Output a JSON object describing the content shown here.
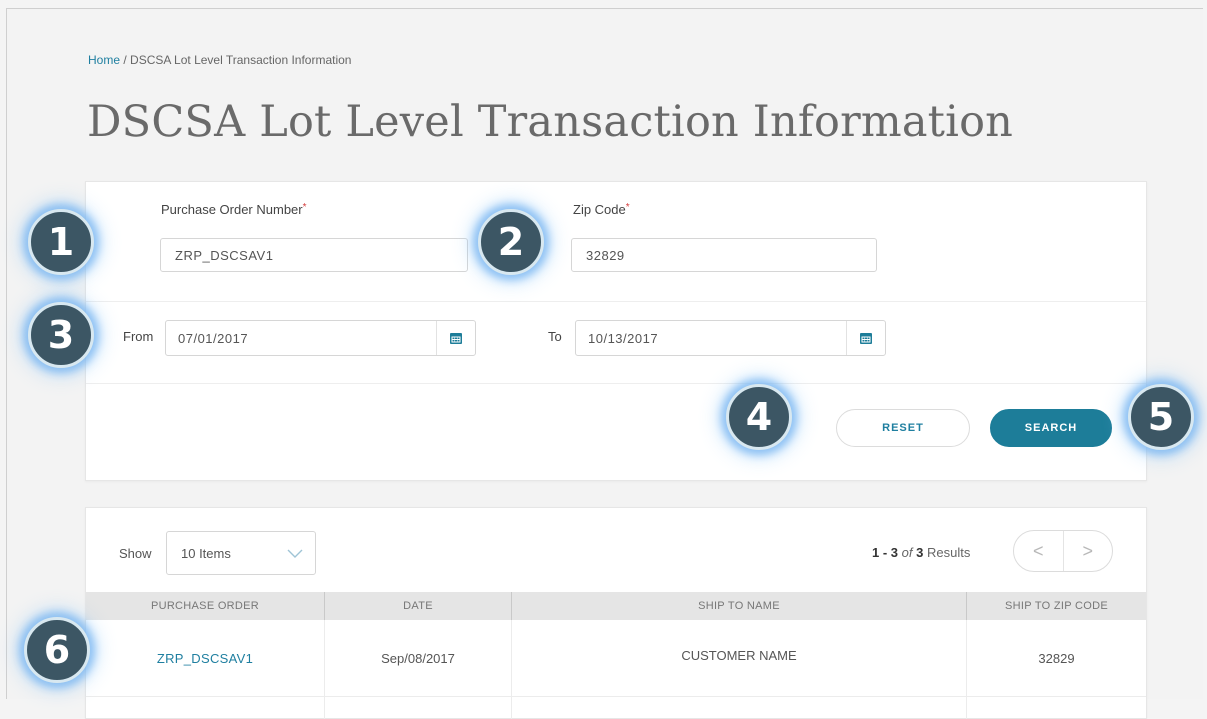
{
  "breadcrumb": {
    "home": "Home",
    "separator": " / ",
    "current": "DSCSA Lot Level Transaction Information"
  },
  "page": {
    "title": "DSCSA Lot Level Transaction Information"
  },
  "form": {
    "po_label": "Purchase Order Number",
    "po_value": "ZRP_DSCSAV1",
    "zip_label": "Zip Code",
    "zip_value": "32829",
    "required_marker": "*",
    "from_label": "From",
    "from_value": "07/01/2017",
    "to_label": "To",
    "to_value": "10/13/2017",
    "reset_label": "RESET",
    "search_label": "SEARCH"
  },
  "badges": [
    "1",
    "2",
    "3",
    "4",
    "5",
    "6"
  ],
  "results": {
    "show_label": "Show",
    "page_size": "10 Items",
    "range": "1 - 3",
    "of": "of",
    "total": "3",
    "results_word": "Results",
    "prev": "<",
    "next": ">",
    "columns": [
      "PURCHASE ORDER",
      "DATE",
      "SHIP TO NAME",
      "SHIP TO ZIP CODE"
    ],
    "rows": [
      {
        "purchase_order": "ZRP_DSCSAV1",
        "date": "Sep/08/2017",
        "ship_to_name": "CUSTOMER NAME",
        "ship_to_zip": "32829"
      }
    ]
  },
  "colors": {
    "accent": "#1d7d99",
    "badge": "#3c5664",
    "link": "#1f7fa0",
    "required": "#d43b3b"
  },
  "icons": {
    "calendar": "calendar-icon",
    "dropdown": "chevron-down-icon"
  }
}
